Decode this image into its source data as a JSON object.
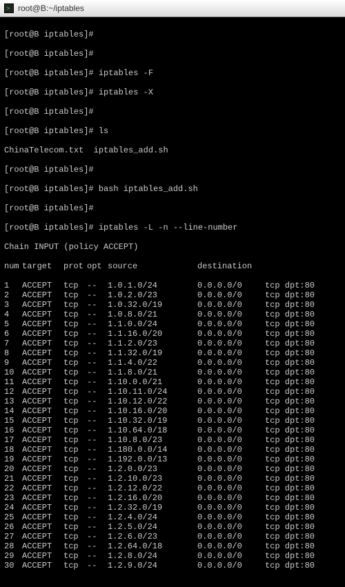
{
  "window": {
    "title": "root@B:~/iptables"
  },
  "prompt": "[root@B iptables]#",
  "ls_files": "ChinaTelecom.txt  iptables_add.sh",
  "commands": {
    "flush": "iptables -F",
    "delchain": "iptables -X",
    "ls": "ls",
    "bash": "bash iptables_add.sh",
    "list": "iptables -L -n --line-number"
  },
  "chain_line": "Chain INPUT (policy ACCEPT)",
  "header": {
    "num": "num",
    "target": "target",
    "prot": "prot",
    "opt": "opt",
    "source": "source",
    "destination": "destination"
  },
  "rule_common": {
    "target": "ACCEPT",
    "prot": "tcp",
    "opt": "--",
    "dst": "0.0.0.0/0",
    "extra": "tcp dpt:80"
  },
  "rules": [
    {
      "num": "1",
      "src": "1.0.1.0/24"
    },
    {
      "num": "2",
      "src": "1.0.2.0/23"
    },
    {
      "num": "3",
      "src": "1.0.32.0/19"
    },
    {
      "num": "4",
      "src": "1.0.8.0/21"
    },
    {
      "num": "5",
      "src": "1.1.0.0/24"
    },
    {
      "num": "6",
      "src": "1.1.16.0/20"
    },
    {
      "num": "7",
      "src": "1.1.2.0/23"
    },
    {
      "num": "8",
      "src": "1.1.32.0/19"
    },
    {
      "num": "9",
      "src": "1.1.4.0/22"
    },
    {
      "num": "10",
      "src": "1.1.8.0/21"
    },
    {
      "num": "11",
      "src": "1.10.0.0/21"
    },
    {
      "num": "12",
      "src": "1.10.11.0/24"
    },
    {
      "num": "13",
      "src": "1.10.12.0/22"
    },
    {
      "num": "14",
      "src": "1.10.16.0/20"
    },
    {
      "num": "15",
      "src": "1.10.32.0/19"
    },
    {
      "num": "16",
      "src": "1.10.64.0/18"
    },
    {
      "num": "17",
      "src": "1.10.8.0/23"
    },
    {
      "num": "18",
      "src": "1.180.0.0/14"
    },
    {
      "num": "19",
      "src": "1.192.0.0/13"
    },
    {
      "num": "20",
      "src": "1.2.0.0/23"
    },
    {
      "num": "21",
      "src": "1.2.10.0/23"
    },
    {
      "num": "22",
      "src": "1.2.12.0/22"
    },
    {
      "num": "23",
      "src": "1.2.16.0/20"
    },
    {
      "num": "24",
      "src": "1.2.32.0/19"
    },
    {
      "num": "25",
      "src": "1.2.4.0/24"
    },
    {
      "num": "26",
      "src": "1.2.5.0/24"
    },
    {
      "num": "27",
      "src": "1.2.6.0/23"
    },
    {
      "num": "28",
      "src": "1.2.64.0/18"
    },
    {
      "num": "29",
      "src": "1.2.8.0/24"
    },
    {
      "num": "30",
      "src": "1.2.9.0/24"
    }
  ]
}
